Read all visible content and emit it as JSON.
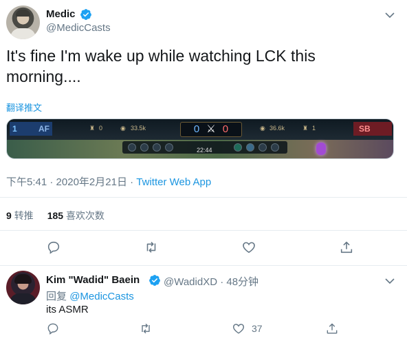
{
  "tweet": {
    "author_name": "Medic",
    "author_handle": "@MedicCasts",
    "text": "It's fine I'm wake up while watching LCK this morning....",
    "translate_label": "翻译推文",
    "media": {
      "team_left_number": "1",
      "team_left": "AF",
      "team_right": "SB",
      "left_kills_stat": "0",
      "left_gold": "33.5k",
      "score_blue": "0",
      "score_red": "0",
      "right_gold": "36.6k",
      "right_kills_stat": "1",
      "game_time": "22:44"
    },
    "time": "下午5:41",
    "date": "2020年2月21日",
    "client": "Twitter Web App",
    "separator": "·",
    "retweet_count": "9",
    "retweet_label": "转推",
    "like_count": "185",
    "like_label": "喜欢次数"
  },
  "reply": {
    "author_name": "Kim \"Wadid\" Baein",
    "author_handle": "@WadidXD",
    "time_ago": "48分钟",
    "separator": "·",
    "reply_prefix": "回复",
    "mention": "@MedicCasts",
    "text": "its ASMR",
    "like_count": "37"
  },
  "icons": {
    "verified": "verified-badge-icon",
    "caret": "chevron-down-icon",
    "reply": "reply-icon",
    "retweet": "retweet-icon",
    "like": "heart-icon",
    "share": "share-icon"
  },
  "colors": {
    "accent": "#1b95e0",
    "text_primary": "#14171a",
    "text_secondary": "#657786",
    "divider": "#e6ecf0"
  }
}
